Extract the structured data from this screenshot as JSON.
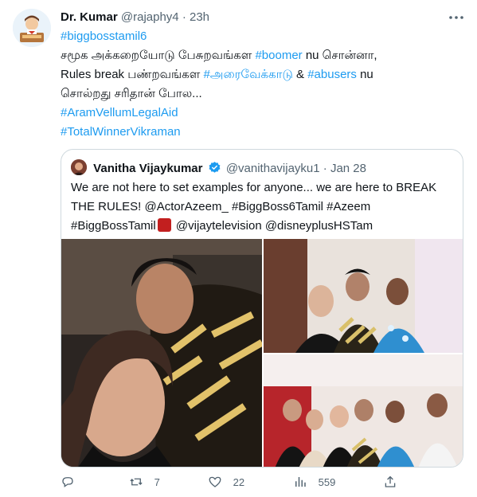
{
  "tweet": {
    "author_name": "Dr. Kumar",
    "author_handle": "@rajaphy4",
    "separator": "·",
    "time": "23h",
    "lines": [
      [
        {
          "t": "#biggbosstamil6",
          "tag": true
        }
      ],
      [
        {
          "t": "சமூக அக்கறையோடு பேசுறவங்கள ",
          "tag": false
        },
        {
          "t": "#boomer",
          "tag": true
        },
        {
          "t": " nu சொன்னா,",
          "tag": false
        }
      ],
      [
        {
          "t": "Rules break பண்றவங்கள ",
          "tag": false
        },
        {
          "t": "#அரைவேக்காடு",
          "tag": true
        },
        {
          "t": " & ",
          "tag": false
        },
        {
          "t": "#abusers",
          "tag": true
        },
        {
          "t": " nu",
          "tag": false
        }
      ],
      [
        {
          "t": "சொல்றது சரிதான் போல...",
          "tag": false
        }
      ],
      [
        {
          "t": " ",
          "tag": false
        }
      ],
      [
        {
          "t": "#AramVellumLegalAid",
          "tag": true
        }
      ],
      [
        {
          "t": "#TotalWinnerVikraman",
          "tag": true
        }
      ]
    ]
  },
  "quoted": {
    "author_name": "Vanitha Vijaykumar",
    "author_handle": "@vanithavijayku1",
    "separator": "·",
    "date": "Jan 28",
    "line1": "We are not here to set examples for anyone... we are here to BREAK",
    "line2": "THE RULES! @ActorAzeem_ #BiggBoss6Tamil #Azeem",
    "line3_a": "#BiggBossTamil",
    "line3_b": " @vijaytelevision @disneyplusHSTam"
  },
  "actions": {
    "reply_count": "",
    "retweet_count": "7",
    "like_count": "22",
    "view_count": "559"
  },
  "colors": {
    "link": "#1d9bf0",
    "secondary_text": "#536471",
    "primary_text": "#0f1419",
    "border": "#cfd9de"
  },
  "icons": [
    "more-icon",
    "verified-icon",
    "reply-icon",
    "retweet-icon",
    "like-icon",
    "views-icon",
    "share-icon",
    "bigg-boss-logo"
  ]
}
